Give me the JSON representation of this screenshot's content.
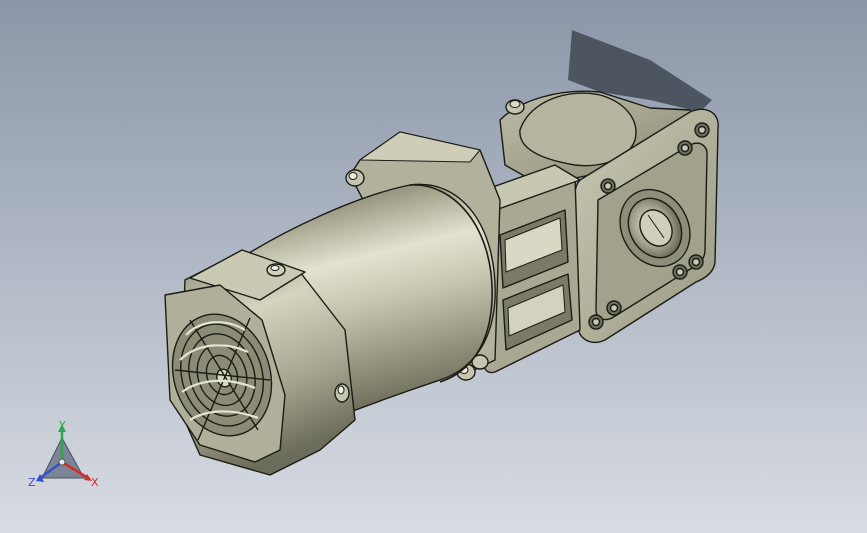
{
  "colors": {
    "bg_top": "#8e99ab",
    "bg_bottom": "#d5d9e1",
    "body_light": "#cfcfb9",
    "body_mid": "#a8a892",
    "body_dark": "#6e6e5c",
    "edge": "#1c1c16",
    "shadow": "#4e5562",
    "axis_x": "#d42a2a",
    "axis_y": "#2aa84a",
    "axis_z": "#3452c8"
  },
  "triad": {
    "x_label": "X",
    "y_label": "Y",
    "z_label": "Z"
  }
}
